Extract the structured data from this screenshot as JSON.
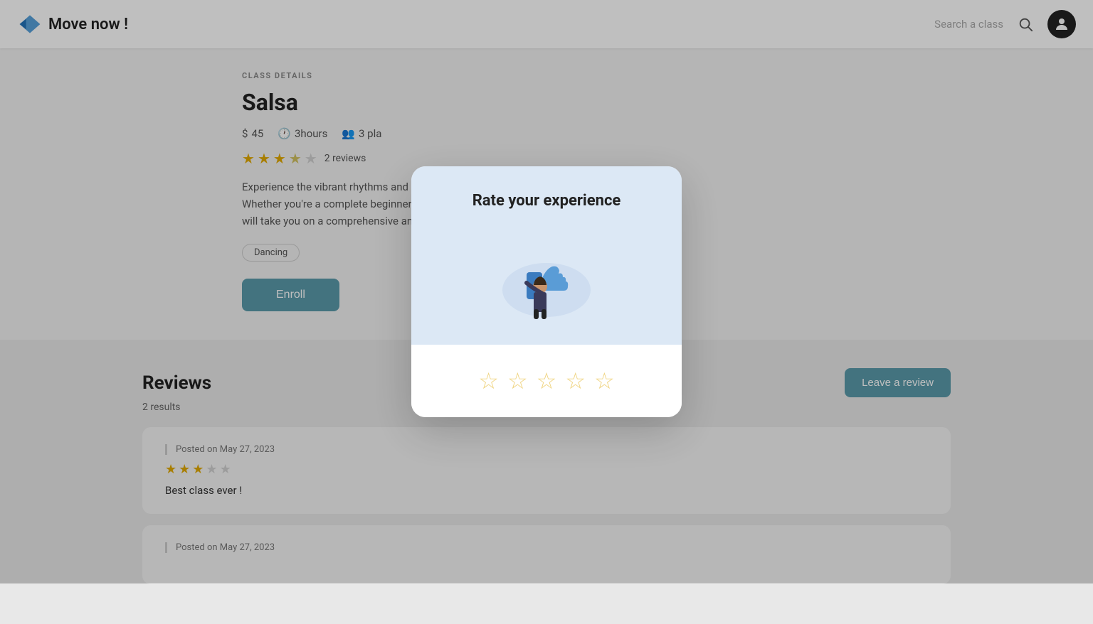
{
  "header": {
    "logo_text": "Move now !",
    "search_placeholder": "Search a class",
    "search_icon": "🔍"
  },
  "class_details": {
    "section_label": "CLASS DETAILS",
    "title": "Salsa",
    "price": "45",
    "duration": "3hours",
    "places": "3 pla",
    "rating": 3.5,
    "review_count": "2 reviews",
    "description": "Experience the vibrant rhythms and fun of salsa dancing in our beginner salsa class. Whether you're a complete beginner or looking to refine your skills, our expert instructors will take you on a comprehensive and fun-filled journey into the world of salsa.",
    "tag": "Dancing",
    "enroll_label": "Enroll",
    "stars_filled": 3,
    "stars_half": 1,
    "stars_empty": 1
  },
  "modal": {
    "title": "Rate your experience",
    "stars_count": 5
  },
  "reviews": {
    "title": "Reviews",
    "results_label": "2 results",
    "leave_review_label": "Leave a review",
    "items": [
      {
        "date": "Posted on May 27, 2023",
        "stars_filled": 3,
        "stars_empty": 2,
        "text": "Best class ever !"
      },
      {
        "date": "Posted on May 27, 2023",
        "stars_filled": 0,
        "stars_empty": 0,
        "text": ""
      }
    ]
  }
}
